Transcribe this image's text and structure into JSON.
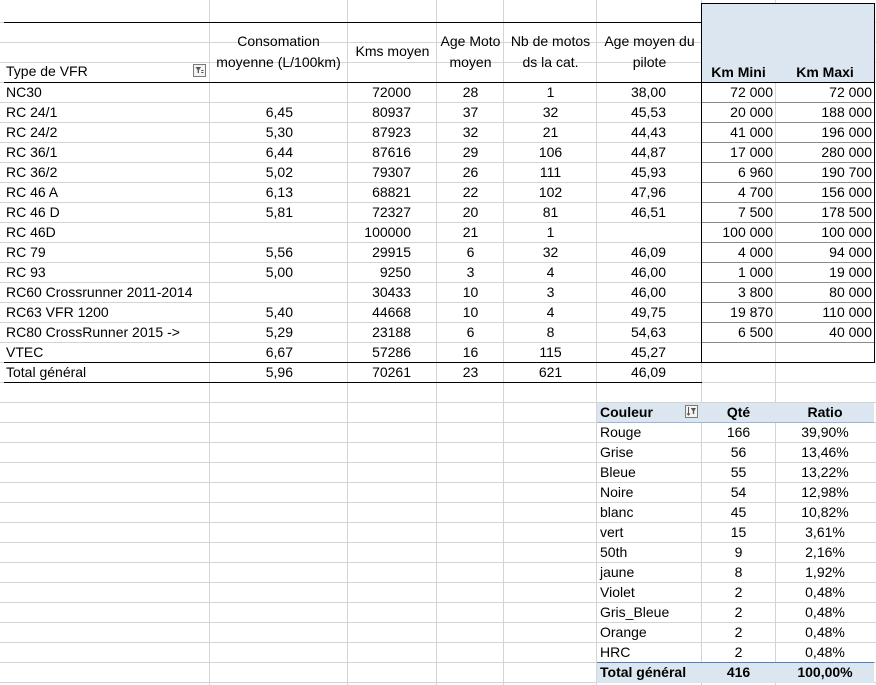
{
  "vfr": {
    "headers": {
      "type": "Type de VFR",
      "conso_l1": "Consomation",
      "conso_l2": "moyenne (L/100km)",
      "kms": "Kms moyen",
      "age_l1": "Age Moto",
      "age_l2": "moyen",
      "nb_l1": "Nb de motos",
      "nb_l2": "ds la cat.",
      "pilote_l1": "Age moyen du",
      "pilote_l2": "pilote"
    },
    "rows": [
      {
        "type": "NC30",
        "conso": "",
        "kms": "72000",
        "age": "28",
        "nb": "1",
        "pilote": "38,00"
      },
      {
        "type": "RC 24/1",
        "conso": "6,45",
        "kms": "80937",
        "age": "37",
        "nb": "32",
        "pilote": "45,53"
      },
      {
        "type": "RC 24/2",
        "conso": "5,30",
        "kms": "87923",
        "age": "32",
        "nb": "21",
        "pilote": "44,43"
      },
      {
        "type": "RC 36/1",
        "conso": "6,44",
        "kms": "87616",
        "age": "29",
        "nb": "106",
        "pilote": "44,87"
      },
      {
        "type": "RC 36/2",
        "conso": "5,02",
        "kms": "79307",
        "age": "26",
        "nb": "111",
        "pilote": "45,93"
      },
      {
        "type": "RC 46 A",
        "conso": "6,13",
        "kms": "68821",
        "age": "22",
        "nb": "102",
        "pilote": "47,96"
      },
      {
        "type": "RC 46 D",
        "conso": "5,81",
        "kms": "72327",
        "age": "20",
        "nb": "81",
        "pilote": "46,51"
      },
      {
        "type": "RC 46D",
        "conso": "",
        "kms": "100000",
        "age": "21",
        "nb": "1",
        "pilote": ""
      },
      {
        "type": "RC 79",
        "conso": "5,56",
        "kms": "29915",
        "age": "6",
        "nb": "32",
        "pilote": "46,09"
      },
      {
        "type": "RC 93",
        "conso": "5,00",
        "kms": "9250",
        "age": "3",
        "nb": "4",
        "pilote": "46,00"
      },
      {
        "type": "RC60 Crossrunner 2011-2014",
        "conso": "",
        "kms": "30433",
        "age": "10",
        "nb": "3",
        "pilote": "46,00"
      },
      {
        "type": "RC63 VFR 1200",
        "conso": "5,40",
        "kms": "44668",
        "age": "10",
        "nb": "4",
        "pilote": "49,75"
      },
      {
        "type": "RC80 CrossRunner 2015 ->",
        "conso": "5,29",
        "kms": "23188",
        "age": "6",
        "nb": "8",
        "pilote": "54,63"
      },
      {
        "type": "VTEC",
        "conso": "6,67",
        "kms": "57286",
        "age": "16",
        "nb": "115",
        "pilote": "45,27"
      }
    ],
    "total": {
      "type": "Total général",
      "conso": "5,96",
      "kms": "70261",
      "age": "23",
      "nb": "621",
      "pilote": "46,09"
    }
  },
  "km": {
    "headers": {
      "mini": "Km Mini",
      "maxi": "Km Maxi"
    },
    "header_bg": "#dce6f1",
    "rows": [
      {
        "mini": "72 000",
        "maxi": "72 000"
      },
      {
        "mini": "20 000",
        "maxi": "188 000"
      },
      {
        "mini": "41 000",
        "maxi": "196 000"
      },
      {
        "mini": "17 000",
        "maxi": "280 000"
      },
      {
        "mini": "6 960",
        "maxi": "190 700"
      },
      {
        "mini": "4 700",
        "maxi": "156 000"
      },
      {
        "mini": "7 500",
        "maxi": "178 500"
      },
      {
        "mini": "100 000",
        "maxi": "100 000"
      },
      {
        "mini": "4 000",
        "maxi": "94 000"
      },
      {
        "mini": "1 000",
        "maxi": "19 000"
      },
      {
        "mini": "3 800",
        "maxi": "80 000"
      },
      {
        "mini": "19 870",
        "maxi": "110 000"
      },
      {
        "mini": "6 500",
        "maxi": "40 000"
      }
    ]
  },
  "couleur": {
    "headers": {
      "couleur": "Couleur",
      "qte": "Qté",
      "ratio": "Ratio"
    },
    "header_bg": "#dce6f1",
    "rows": [
      {
        "couleur": "Rouge",
        "qte": "166",
        "ratio": "39,90%"
      },
      {
        "couleur": "Grise",
        "qte": "56",
        "ratio": "13,46%"
      },
      {
        "couleur": "Bleue",
        "qte": "55",
        "ratio": "13,22%"
      },
      {
        "couleur": "Noire",
        "qte": "54",
        "ratio": "12,98%"
      },
      {
        "couleur": "blanc",
        "qte": "45",
        "ratio": "10,82%"
      },
      {
        "couleur": "vert",
        "qte": "15",
        "ratio": "3,61%"
      },
      {
        "couleur": "50th",
        "qte": "9",
        "ratio": "2,16%"
      },
      {
        "couleur": "jaune",
        "qte": "8",
        "ratio": "1,92%"
      },
      {
        "couleur": "Violet",
        "qte": "2",
        "ratio": "0,48%"
      },
      {
        "couleur": "Gris_Bleue",
        "qte": "2",
        "ratio": "0,48%"
      },
      {
        "couleur": "Orange",
        "qte": "2",
        "ratio": "0,48%"
      },
      {
        "couleur": "HRC",
        "qte": "2",
        "ratio": "0,48%"
      }
    ],
    "total": {
      "couleur": "Total général",
      "qte": "416",
      "ratio": "100,00%"
    }
  }
}
